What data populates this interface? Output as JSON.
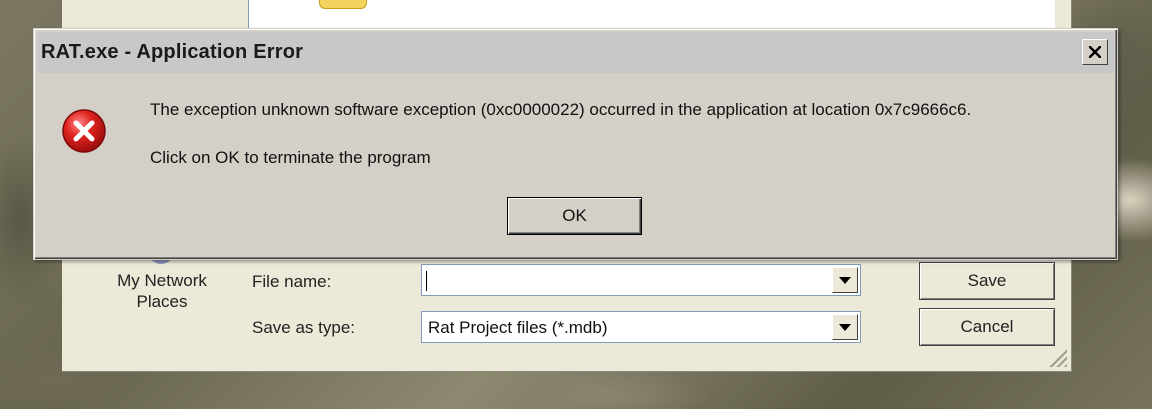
{
  "save_dialog": {
    "places": [
      {
        "label_line1": "My Network",
        "label_line2": "Places",
        "icon": "network-places-icon"
      }
    ],
    "file_name_label": "File name:",
    "file_name_value": "",
    "save_as_type_label": "Save as type:",
    "save_as_type_value": "Rat Project files (*.mdb)",
    "save_button": "Save",
    "cancel_button": "Cancel"
  },
  "error_dialog": {
    "title": "RAT.exe - Application Error",
    "icon": "error-icon",
    "message_line1": "The exception unknown software exception (0xc0000022) occurred in the application at location 0x7c9666c6.",
    "message_line2": "Click on OK to terminate the program",
    "ok_button": "OK",
    "close_button_icon": "close-icon"
  },
  "colors": {
    "dialog_face": "#d4d0c8",
    "titlebar": "#c8c8c8",
    "error_red": "#c8102e",
    "xp_face": "#ece9d8"
  }
}
